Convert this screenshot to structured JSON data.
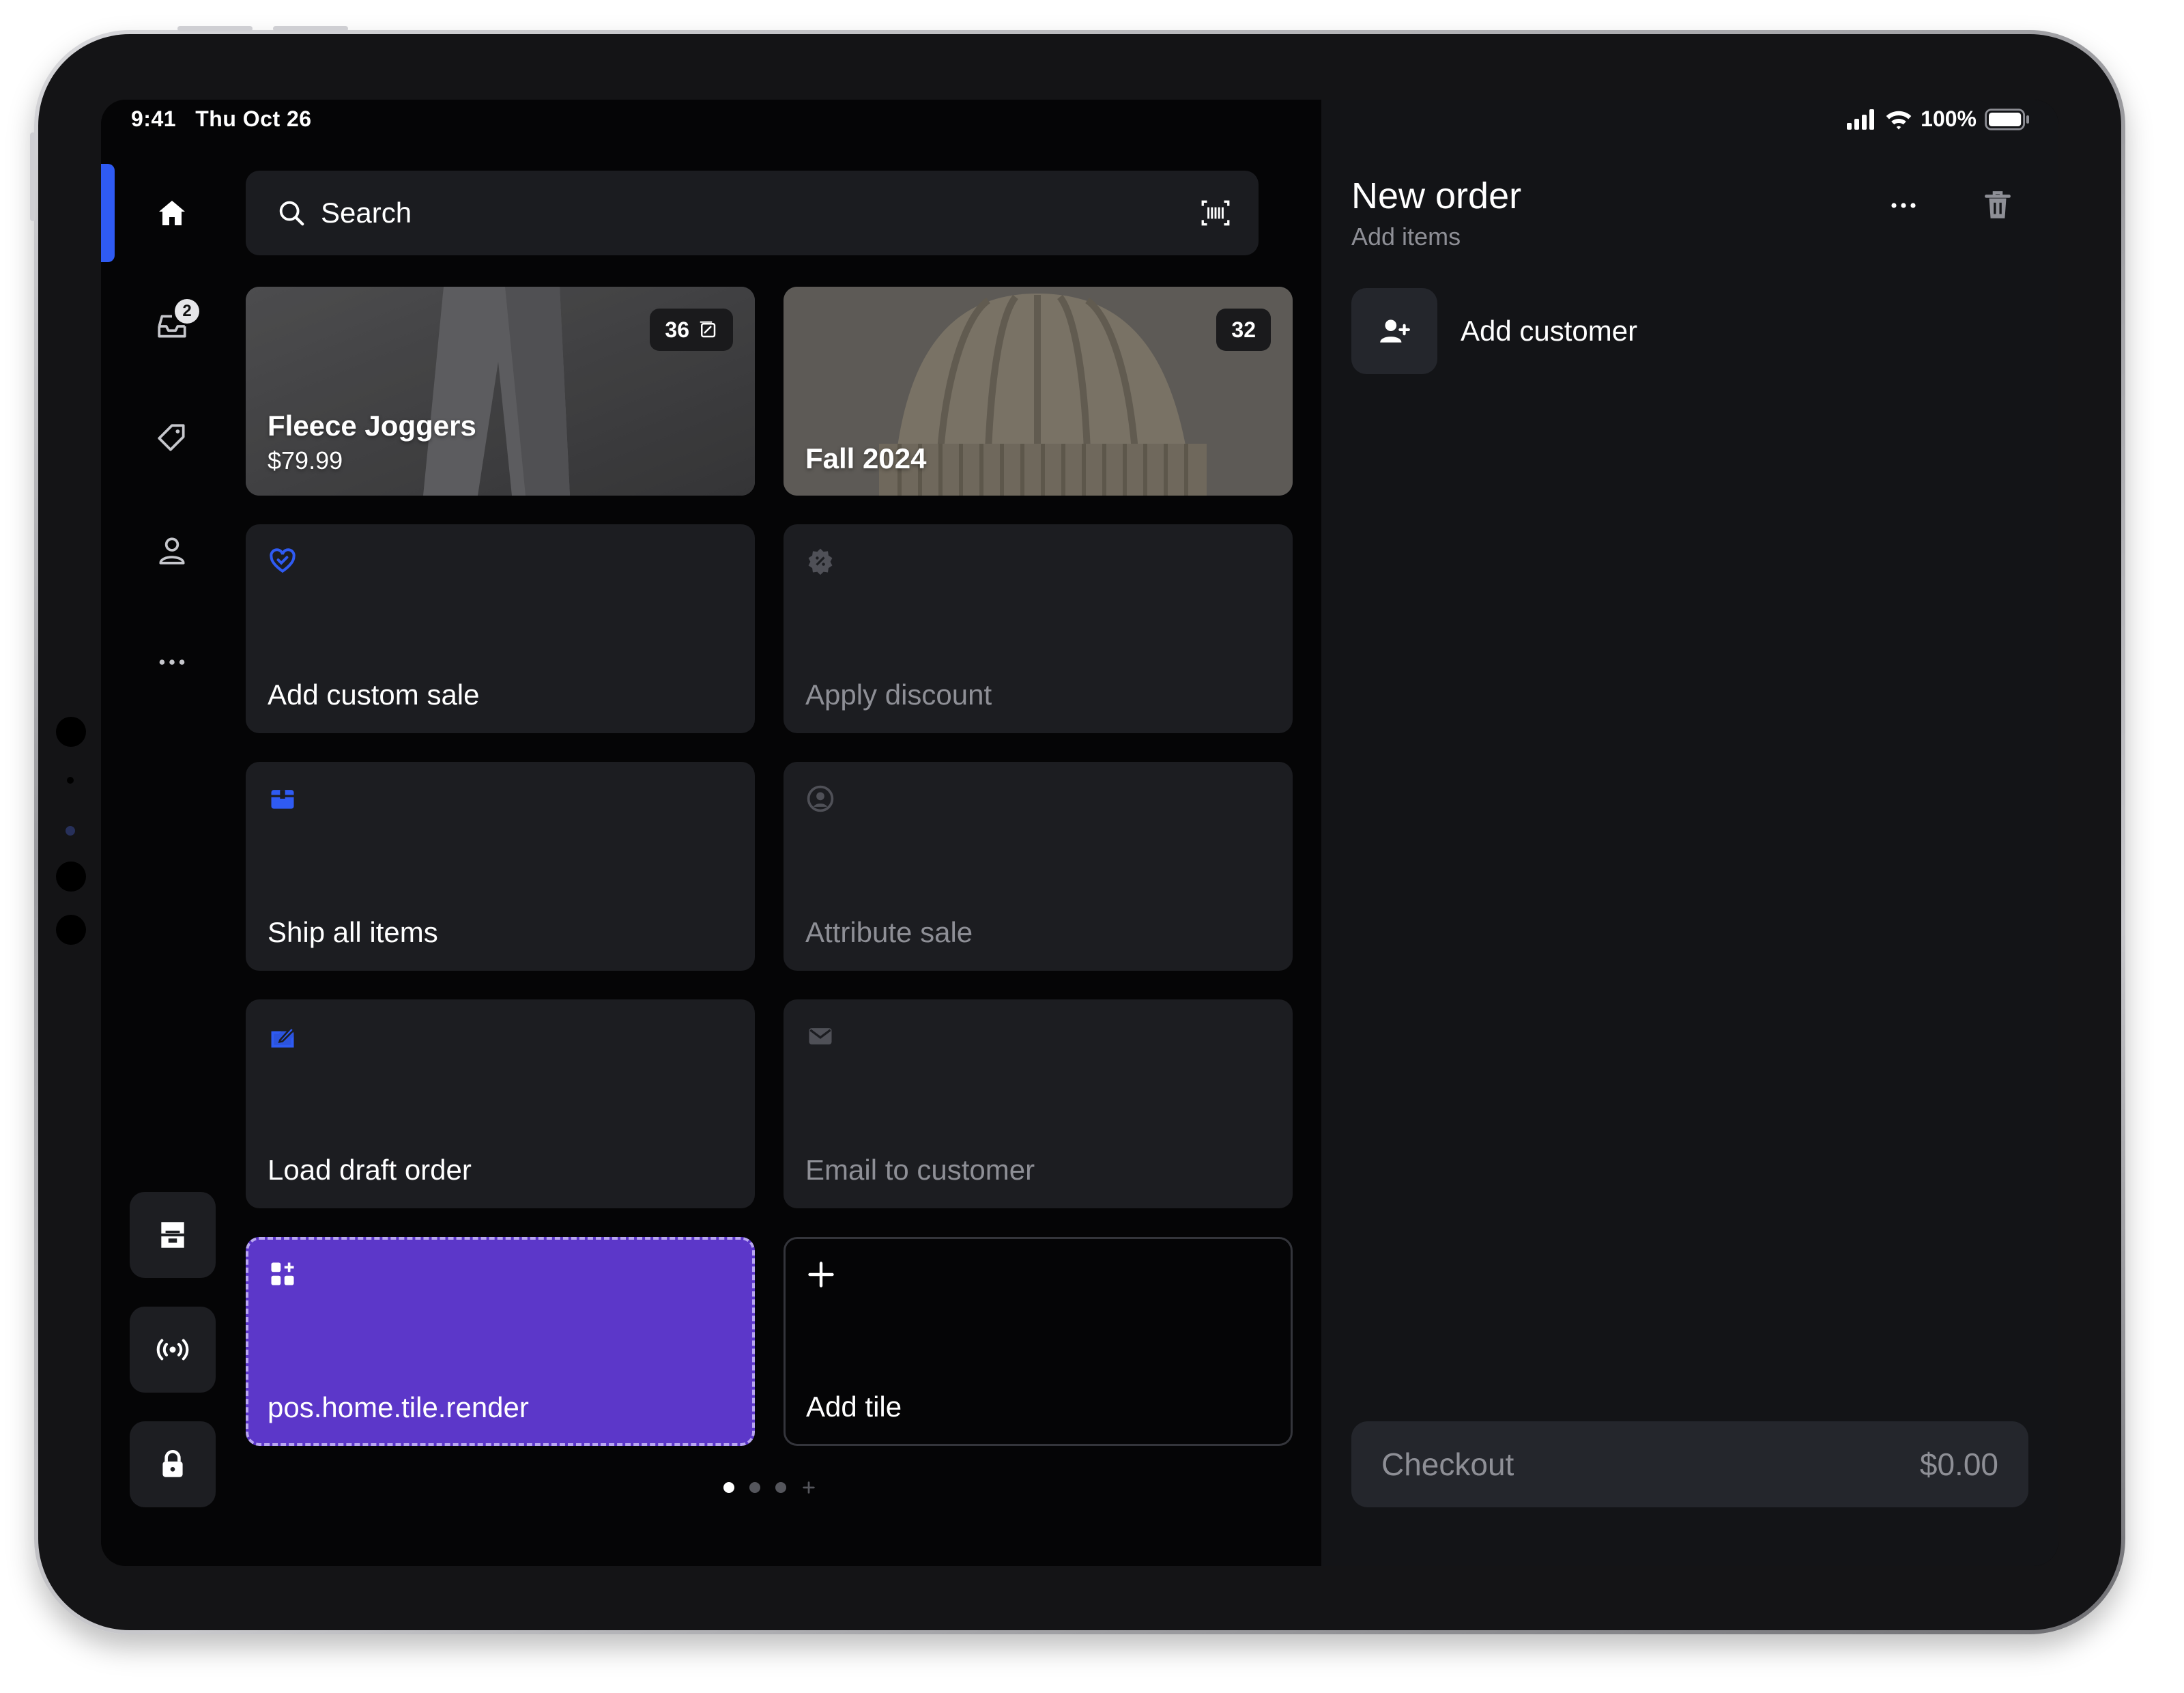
{
  "status_bar": {
    "time": "9:41",
    "date": "Thu Oct 26",
    "battery": "100%"
  },
  "nav": {
    "items": [
      {
        "icon": "home-icon",
        "active": true
      },
      {
        "icon": "inbox-icon",
        "badge": "2"
      },
      {
        "icon": "tag-icon"
      },
      {
        "icon": "person-icon"
      },
      {
        "icon": "more-icon"
      }
    ],
    "bottom_buttons": [
      "store-icon",
      "broadcast-icon",
      "lock-icon"
    ]
  },
  "search": {
    "placeholder": "Search"
  },
  "tiles": {
    "product": {
      "title": "Fleece Joggers",
      "price": "$79.99",
      "count": "36"
    },
    "collection": {
      "title": "Fall 2024",
      "count": "32"
    },
    "custom_sale": {
      "label": "Add custom sale"
    },
    "apply_discount": {
      "label": "Apply discount"
    },
    "ship_all": {
      "label": "Ship all items"
    },
    "attribute_sale": {
      "label": "Attribute sale"
    },
    "load_draft": {
      "label": "Load draft order"
    },
    "email_customer": {
      "label": "Email to customer"
    },
    "extension": {
      "label": "pos.home.tile.render"
    },
    "add_tile": {
      "label": "Add tile"
    }
  },
  "pager": {
    "pages": 3,
    "current": 1
  },
  "order": {
    "title": "New order",
    "subtitle": "Add items",
    "add_customer": "Add customer",
    "checkout_label": "Checkout",
    "total": "$0.00"
  },
  "colors": {
    "accent_blue": "#2f5bf3",
    "extension_purple": "#5c37c9",
    "tile_bg": "#1c1d21",
    "panel_bg": "#131417"
  }
}
